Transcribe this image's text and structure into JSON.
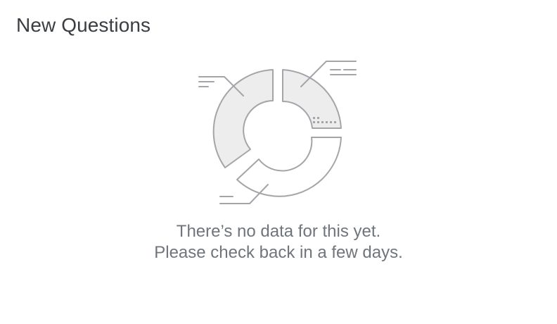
{
  "widget": {
    "title": "New Questions"
  },
  "empty_state": {
    "illustration": "donut-chart-placeholder-icon",
    "line1": "There’s no data for this yet.",
    "line2": "Please check back in a few days."
  },
  "colors": {
    "title_text": "#3a3d42",
    "message_text": "#70757c",
    "illustration_stroke": "#a3a5a9",
    "illustration_fill": "#ededee"
  }
}
